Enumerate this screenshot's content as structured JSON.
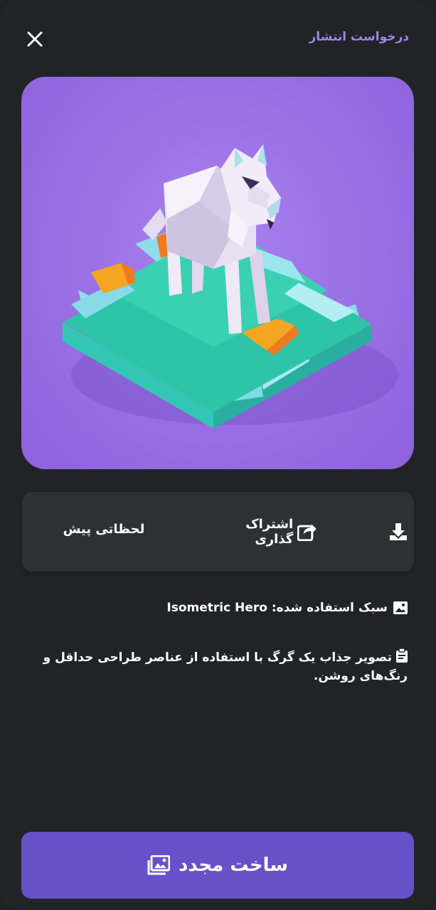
{
  "header": {
    "close_icon": "close-icon",
    "publish_request": "درخواست انتشار"
  },
  "artwork": {
    "subject": "wolf-on-isometric-tile"
  },
  "actions": {
    "download_icon": "download-icon",
    "share_label": "اشتراک گذاری",
    "share_icon": "share-icon",
    "moments_label": "لحظاتی پیش"
  },
  "details": {
    "style_icon": "image-icon",
    "style_text": "سبک استفاده شده: Isometric Hero",
    "prompt_icon": "clipboard-icon",
    "prompt_text": "تصویر جذاب یک گرگ با استفاده از عناصر طراحی حداقل و رنگ‌های روشن."
  },
  "footer": {
    "regenerate_label": "ساخت مجدد",
    "regenerate_icon": "images-icon"
  },
  "colors": {
    "background": "#222326",
    "accent": "#6651c9",
    "link": "#9b86f3",
    "card": "#2f3034"
  }
}
